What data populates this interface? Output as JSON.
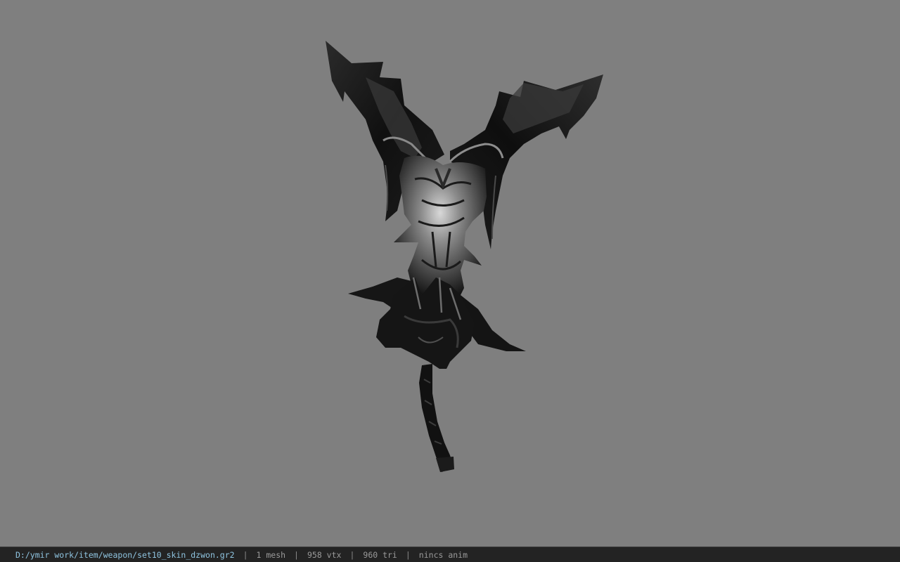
{
  "viewer": {
    "background": "#7f7f7f",
    "model_icon": "weapon-model"
  },
  "status": {
    "path": "D:/ymir work/item/weapon/set10_skin_dzwon.gr2",
    "separator": "|",
    "meshes": "1 mesh",
    "vertices": "958 vtx",
    "triangles": "960 tri",
    "anim": "nincs anim",
    "path_color": "#8fc4e0",
    "bar_color": "#232323"
  }
}
